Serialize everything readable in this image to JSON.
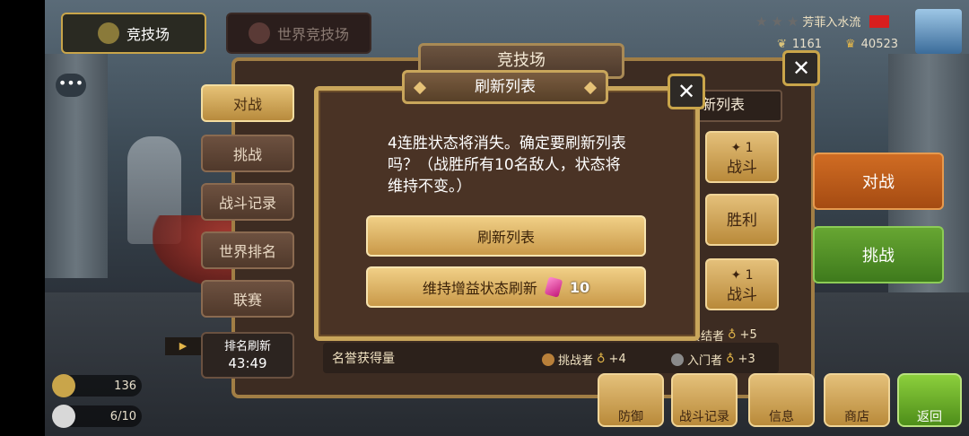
{
  "top_tabs": {
    "arena": "竞技场",
    "world_arena": "世界竞技场"
  },
  "player": {
    "name": "芳菲入水流",
    "trophy_a": "1161",
    "trophy_b": "40523"
  },
  "main_panel": {
    "title": "竞技场"
  },
  "side_nav": [
    {
      "label": "对战"
    },
    {
      "label": "挑战"
    },
    {
      "label": "战斗记录"
    },
    {
      "label": "世界排名"
    },
    {
      "label": "联赛"
    }
  ],
  "rank_refresh": {
    "label": "排名刷新",
    "time": "43:49"
  },
  "resources": {
    "coins": "136",
    "wings": "6/10"
  },
  "right_panel": {
    "list_header": "新列表",
    "fight_cost": "1",
    "fight_label": "战斗",
    "win_label": "胜利",
    "big_battle": "对战",
    "big_challenge": "挑战"
  },
  "honor": {
    "label": "名誉获得量",
    "challenger": "挑战者",
    "challenger_bonus": "+4",
    "novice": "入门者",
    "novice_bonus": "+3",
    "finisher": "终结者",
    "finisher_bonus": "+5"
  },
  "bottom_bar": [
    "防御",
    "战斗记录",
    "信息",
    "商店",
    "返回"
  ],
  "dialog": {
    "title": "刷新列表",
    "message": "4连胜状态将消失。确定要刷新列表吗？（战胜所有10名敌人，状态将维持不变。）",
    "refresh_button": "刷新列表",
    "keep_buff_button": "维持增益状态刷新",
    "gem_cost": "10",
    "close_glyph": "✕"
  },
  "colors": {
    "gold": "#c9a65b",
    "dialog_bg": "#4a3325",
    "button_gold": "#e4c07a",
    "orange": "#d06c23",
    "green": "#67a632"
  }
}
